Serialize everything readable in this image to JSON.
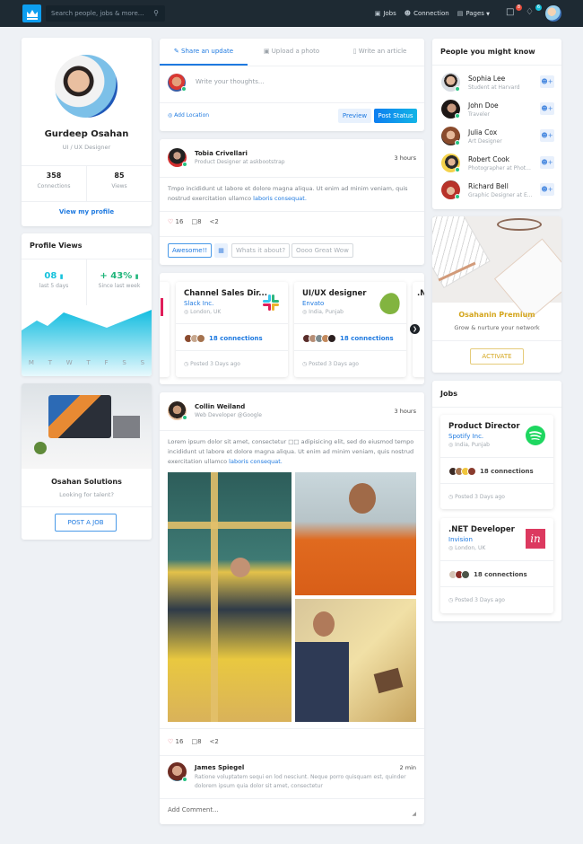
{
  "navbar": {
    "search_placeholder": "Search people, jobs & more...",
    "links": [
      {
        "icon": "briefcase-icon",
        "label": "Jobs"
      },
      {
        "icon": "users-icon",
        "label": "Connection"
      },
      {
        "icon": "file-icon",
        "label": "Pages"
      }
    ],
    "messages_badge": "8",
    "notifications_badge": "6",
    "colors": {
      "bg": "#1e2a33",
      "brand": "#0d9ef0",
      "badge_red": "#e74c3c",
      "badge_cyan": "#16c2dc"
    }
  },
  "profile": {
    "name": "Gurdeep Osahan",
    "title": "UI / UX Designer",
    "stats": [
      {
        "value": "358",
        "label": "Connections"
      },
      {
        "value": "85",
        "label": "Views"
      }
    ],
    "link": "View my profile"
  },
  "profile_views": {
    "title": "Profile Views",
    "stats": [
      {
        "value": "08",
        "label": "last 5 days",
        "color": "#16c2dc"
      },
      {
        "value": "+ 43%",
        "label": "Since last week",
        "color": "#1fb57a"
      }
    ],
    "chart_days": [
      "M",
      "T",
      "W",
      "T",
      "F",
      "S",
      "S"
    ]
  },
  "company": {
    "name": "Osahan Solutions",
    "subtitle": "Looking for talent?",
    "button": "POST A JOB"
  },
  "composer": {
    "tabs": [
      {
        "icon": "edit-icon",
        "label": "Share an update",
        "active": true
      },
      {
        "icon": "image-icon",
        "label": "Upload a photo",
        "active": false
      },
      {
        "icon": "article-icon",
        "label": "Write an article",
        "active": false
      }
    ],
    "placeholder": "Write your thoughts...",
    "location": "Add Location",
    "preview": "Preview",
    "post": "Post Status"
  },
  "post1": {
    "author": "Tobia Crivellari",
    "role": "Product Designer at askbootstrap",
    "time": "3 hours",
    "text": "Tmpo incididunt ut labore et dolore magna aliqua. Ut enim ad minim veniam, quis nostrud exercitation ullamco ",
    "link": "laboris consequat.",
    "likes": "16",
    "comments": "8",
    "shares": "2",
    "replies": [
      "Awesome!!",
      "Whats it about?",
      "Oooo Great Wow"
    ]
  },
  "job_carousel": [
    {
      "title": "Channel Sales Dir...",
      "company": "Slack Inc.",
      "location": "London, UK",
      "connections": "18 connections",
      "posted": "Posted 3 Days ago"
    },
    {
      "title": "UI/UX designer",
      "company": "Envato",
      "location": "India, Punjab",
      "connections": "18 connections",
      "posted": "Posted 3 Days ago"
    }
  ],
  "post2": {
    "author": "Collin Weiland",
    "role": "Web Developer @Google",
    "time": "3 hours",
    "text": "Lorem ipsum dolor sit amet, consectetur □□ adipisicing elit, sed do eiusmod tempo incididunt ut labore et dolore magna aliqua. Ut enim ad minim veniam, quis nostrud exercitation ullamco ",
    "link": "laboris consequat.",
    "likes": "16",
    "comments": "8",
    "shares": "2",
    "comment": {
      "author": "James Spiegel",
      "time": "2 min",
      "text": "Ratione voluptatem sequi en lod nesciunt. Neque porro quisquam est, quinder dolorem ipsum quia dolor sit amet, consectetur"
    },
    "add_comment_placeholder": "Add Comment..."
  },
  "people": {
    "title": "People you might know",
    "list": [
      {
        "name": "Sophia Lee",
        "sub": "Student at Harvard"
      },
      {
        "name": "John Doe",
        "sub": "Traveler"
      },
      {
        "name": "Julia Cox",
        "sub": "Art Designer"
      },
      {
        "name": "Robert Cook",
        "sub": "Photographer at Phot..."
      },
      {
        "name": "Richard Bell",
        "sub": "Graphic Designer at E..."
      }
    ]
  },
  "premium": {
    "title": "Osahanin Premium",
    "subtitle": "Grow & nurture your network",
    "button": "ACTIVATE",
    "color": "#d4a51c"
  },
  "jobs": {
    "title": "Jobs",
    "list": [
      {
        "title": "Product Director",
        "company": "Spotify Inc.",
        "location": "India, Punjab",
        "connections": "18 connections",
        "posted": "Posted 3 Days ago"
      },
      {
        "title": ".NET Developer",
        "company": "Invision",
        "location": "London, UK",
        "connections": "18 connections",
        "posted": "Posted 3 Days ago"
      }
    ]
  }
}
